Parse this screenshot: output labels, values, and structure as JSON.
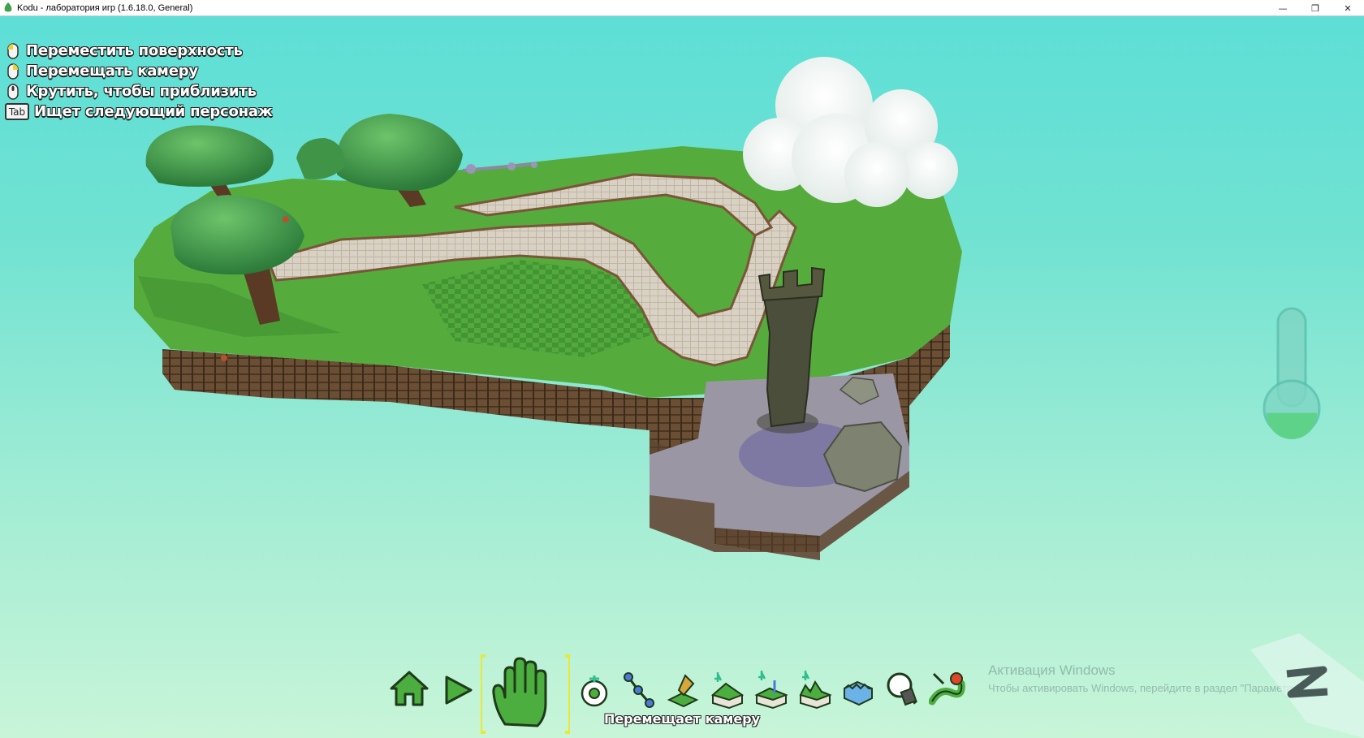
{
  "window": {
    "title": "Kodu - лаборатория игр (1.6.18.0, General)",
    "minimize": "—",
    "restore": "❐",
    "close": "✕"
  },
  "hints": [
    {
      "icon": "mouse-left-icon",
      "text": "Переместить поверхность"
    },
    {
      "icon": "mouse-right-icon",
      "text": "Перемещать камеру"
    },
    {
      "icon": "mouse-wheel-icon",
      "text": "Крутить, чтобы приблизить"
    },
    {
      "icon": "tab-key-icon",
      "key": "Tab",
      "text": "Ищет следующий персонаж"
    }
  ],
  "toolbar": {
    "tools": [
      {
        "name": "home-icon"
      },
      {
        "name": "play-icon"
      },
      {
        "name": "hand-icon",
        "selected": true
      },
      {
        "name": "object-tool-icon"
      },
      {
        "name": "path-tool-icon"
      },
      {
        "name": "terrain-paint-icon"
      },
      {
        "name": "terrain-raise-icon"
      },
      {
        "name": "terrain-smooth-icon"
      },
      {
        "name": "terrain-roughen-icon"
      },
      {
        "name": "water-tool-icon"
      },
      {
        "name": "erase-tool-icon"
      },
      {
        "name": "world-settings-icon"
      }
    ],
    "caption": "Перемещает камеру"
  },
  "thermometer": {
    "fill_fraction": 0.2
  },
  "activation": {
    "title": "Активация Windows",
    "subtitle": "Чтобы активировать Windows, перейдите в раздел \"Параметры\"."
  },
  "colors": {
    "sky_top": "#5ddfd6",
    "sky_bottom": "#c8f5d8",
    "grass": "#4fa93a",
    "dirt": "#6b4f35",
    "path": "#d8d0c2",
    "stone": "#9a96a4",
    "tool_green": "#4cae3f",
    "selection": "#e8e83a"
  }
}
